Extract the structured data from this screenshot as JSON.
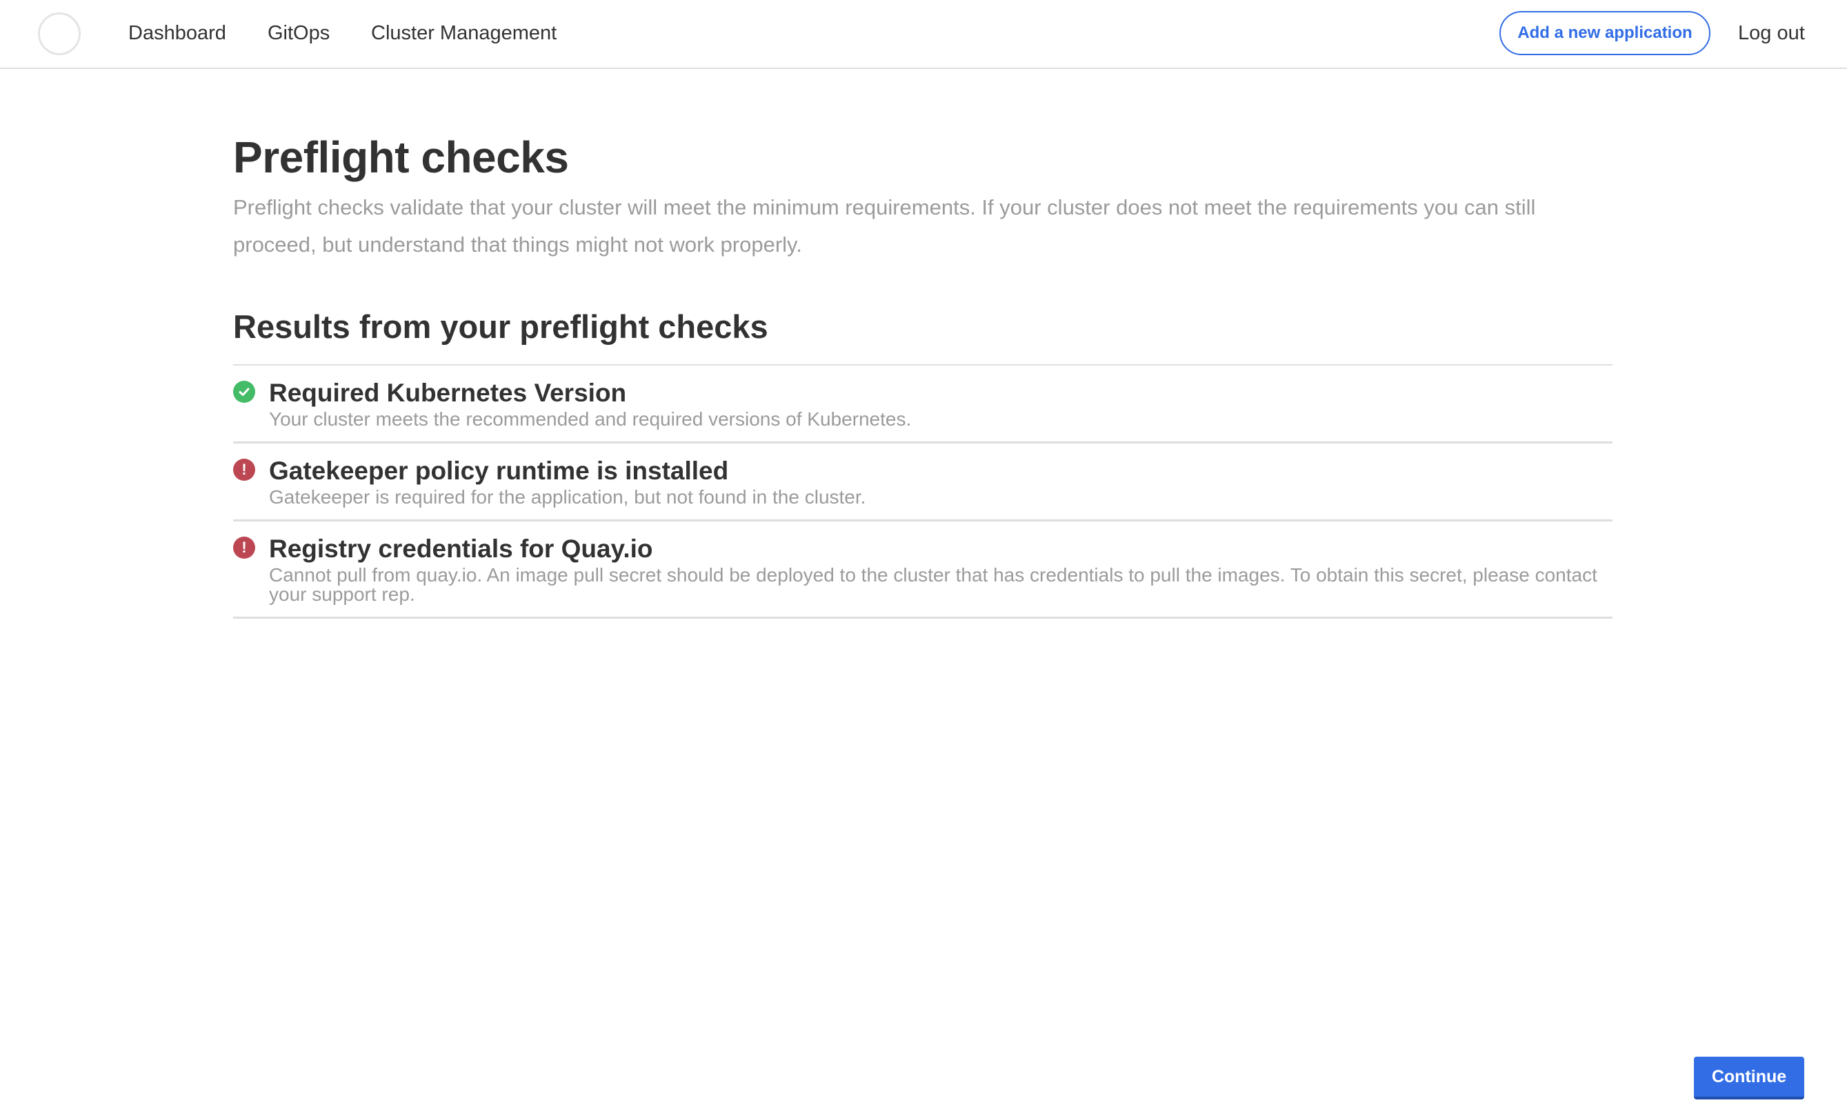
{
  "nav": {
    "links": [
      "Dashboard",
      "GitOps",
      "Cluster Management"
    ],
    "add_app_label": "Add a new application",
    "logout_label": "Log out"
  },
  "page": {
    "title": "Preflight checks",
    "description": "Preflight checks validate that your cluster will meet the minimum requirements. If your cluster does not meet the requirements you can still proceed, but understand that things might not work properly.",
    "results_title": "Results from your preflight checks"
  },
  "results": [
    {
      "status": "pass",
      "icon": "check-circle-icon",
      "title": "Required Kubernetes Version",
      "message": "Your cluster meets the recommended and required versions of Kubernetes."
    },
    {
      "status": "fail",
      "icon": "error-circle-icon",
      "title": "Gatekeeper policy runtime is installed",
      "message": "Gatekeeper is required for the application, but not found in the cluster."
    },
    {
      "status": "fail",
      "icon": "error-circle-icon",
      "title": "Registry credentials for Quay.io",
      "message": "Cannot pull from quay.io. An image pull secret should be deployed to the cluster that has credentials to pull the images. To obtain this secret, please contact your support rep."
    }
  ],
  "actions": {
    "continue_label": "Continue"
  },
  "colors": {
    "accent": "#326de6",
    "pass": "#44bb66",
    "fail": "#bc4752",
    "muted_text": "#9b9b9b",
    "text": "#323232"
  }
}
